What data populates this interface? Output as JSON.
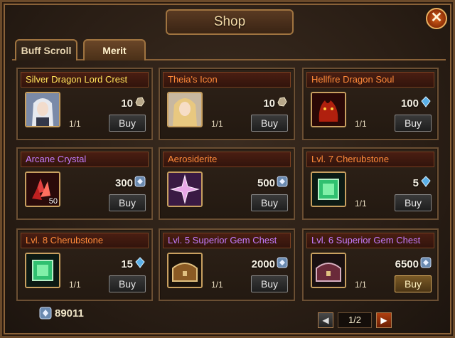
{
  "window": {
    "title": "Shop",
    "close_label": "✕"
  },
  "tabs": [
    {
      "label": "Buff Scroll"
    },
    {
      "label": "Merit"
    }
  ],
  "items": [
    {
      "name": "Silver Dragon Lord Crest",
      "name_color": "yellow",
      "price": "10",
      "currency": "rough-stone",
      "limit": "1/1",
      "buy_label": "Buy",
      "icon": "portrait-silver-hair-icon",
      "icon_qty": ""
    },
    {
      "name": "Theia's Icon",
      "name_color": "orange",
      "price": "10",
      "currency": "rough-stone",
      "limit": "1/1",
      "buy_label": "Buy",
      "icon": "portrait-blonde-icon",
      "icon_qty": ""
    },
    {
      "name": "Hellfire Dragon Soul",
      "name_color": "orange",
      "price": "100",
      "currency": "crystal",
      "limit": "1/1",
      "buy_label": "Buy",
      "icon": "red-dragon-icon",
      "icon_qty": ""
    },
    {
      "name": "Arcane Crystal",
      "name_color": "purple",
      "price": "300",
      "currency": "merit",
      "limit": "",
      "buy_label": "Buy",
      "icon": "red-crystal-icon",
      "icon_qty": "50"
    },
    {
      "name": "Aerosiderite",
      "name_color": "orange",
      "price": "500",
      "currency": "merit",
      "limit": "",
      "buy_label": "Buy",
      "icon": "star-gem-icon",
      "icon_qty": ""
    },
    {
      "name": "Lvl. 7 Cherubstone",
      "name_color": "orange",
      "price": "5",
      "currency": "crystal",
      "limit": "1/1",
      "buy_label": "Buy",
      "icon": "green-square-gem-icon",
      "icon_qty": ""
    },
    {
      "name": "Lvl. 8 Cherubstone",
      "name_color": "orange",
      "price": "15",
      "currency": "crystal",
      "limit": "1/1",
      "buy_label": "Buy",
      "icon": "green-square-gem-icon",
      "icon_qty": ""
    },
    {
      "name": "Lvl. 5 Superior Gem Chest",
      "name_color": "purple",
      "price": "2000",
      "currency": "merit",
      "limit": "1/1",
      "buy_label": "Buy",
      "icon": "chest-icon",
      "icon_qty": ""
    },
    {
      "name": "Lvl. 6 Superior Gem Chest",
      "name_color": "purple",
      "price": "6500",
      "currency": "merit",
      "limit": "1/1",
      "buy_label": "Buy",
      "icon": "chest-purple-icon",
      "icon_qty": "",
      "highlight": true
    }
  ],
  "footer": {
    "merit_total": "89011"
  },
  "pager": {
    "label": "1/2",
    "prev": "◀",
    "next": "▶"
  },
  "colors": {
    "frame": "#8a6238",
    "name_yellow": "#ffe25a",
    "name_orange": "#ff8a3a",
    "name_purple": "#c57cff"
  }
}
